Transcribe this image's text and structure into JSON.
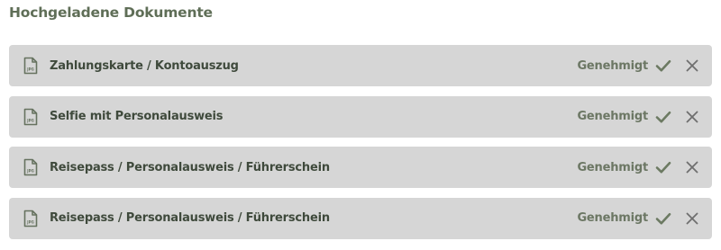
{
  "section": {
    "title": "Hochgeladene Dokumente"
  },
  "documents": [
    {
      "name": "Zahlungskarte / Kontoauszug",
      "status": "Genehmigt",
      "icon": "jpg-file-icon"
    },
    {
      "name": "Selfie mit Personalausweis",
      "status": "Genehmigt",
      "icon": "jpg-file-icon"
    },
    {
      "name": "Reisepass / Personalausweis / Führerschein",
      "status": "Genehmigt",
      "icon": "jpg-file-icon"
    },
    {
      "name": "Reisepass / Personalausweis / Führerschein",
      "status": "Genehmigt",
      "icon": "jpg-file-icon"
    }
  ],
  "icons": {
    "file_badge": "JPG",
    "approved": "check-icon",
    "remove": "close-icon"
  },
  "colors": {
    "title": "#5f6e57",
    "row_background": "#d6d6d6",
    "text": "#3f4a3c",
    "status": "#6c7764",
    "check": "#6c7a62",
    "close": "#6f6f6f"
  }
}
